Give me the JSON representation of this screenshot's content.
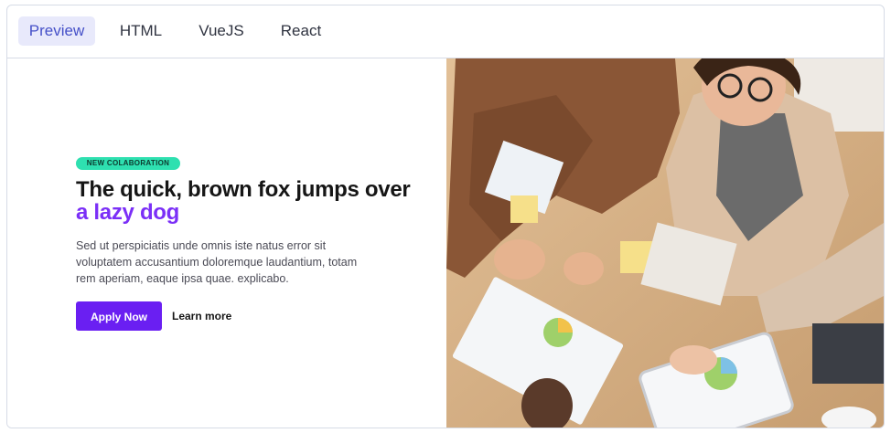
{
  "tabs": [
    {
      "label": "Preview",
      "active": true
    },
    {
      "label": "HTML",
      "active": false
    },
    {
      "label": "VueJS",
      "active": false
    },
    {
      "label": "React",
      "active": false
    }
  ],
  "hero": {
    "badge": "NEW COLABORATION",
    "headline_part1": "The quick, brown fox jumps over ",
    "headline_accent": "a lazy dog",
    "description": "Sed ut perspiciatis unde omnis iste natus error sit voluptatem accusantium doloremque laudantium, totam rem aperiam, eaque ipsa quae. explicabo.",
    "apply_label": "Apply Now",
    "learn_label": "Learn more"
  },
  "colors": {
    "accent": "#7b2ff7",
    "button": "#6a1ff2",
    "badge": "#2ee0b0",
    "tab_active_bg": "#e8e9fb"
  },
  "image": {
    "icon": "team-collaboration-photo"
  }
}
